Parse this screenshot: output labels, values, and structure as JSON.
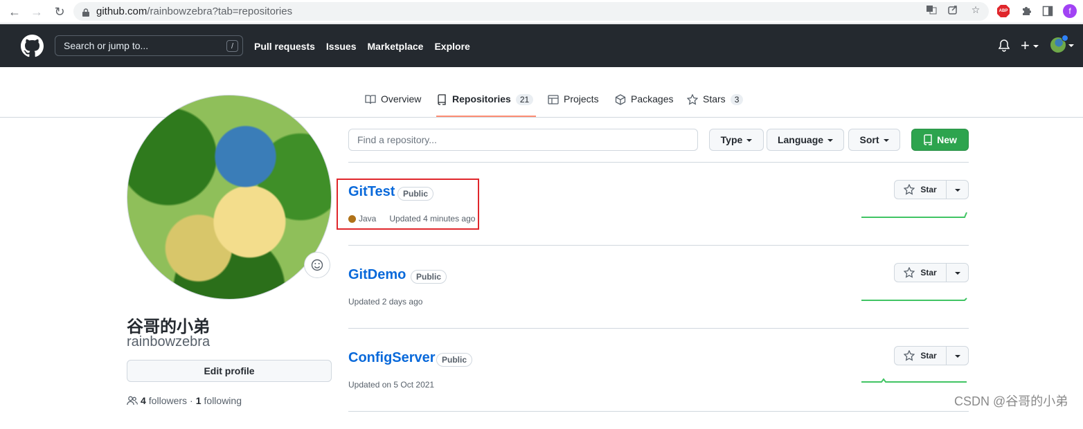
{
  "browser": {
    "url_host": "github.com",
    "url_rest": "/rainbowzebra?tab=repositories",
    "profile_initial": "f",
    "abp_label": "ABP"
  },
  "header": {
    "search_placeholder": "Search or jump to...",
    "search_key": "/",
    "nav": [
      "Pull requests",
      "Issues",
      "Marketplace",
      "Explore"
    ],
    "plus": "+"
  },
  "tabs": [
    {
      "label": "Overview",
      "icon": "book-icon"
    },
    {
      "label": "Repositories",
      "icon": "repo-icon",
      "count": "21"
    },
    {
      "label": "Projects",
      "icon": "table-icon"
    },
    {
      "label": "Packages",
      "icon": "package-icon"
    },
    {
      "label": "Stars",
      "icon": "star-icon",
      "count": "3"
    }
  ],
  "profile": {
    "name": "谷哥的小弟",
    "login": "rainbowzebra",
    "edit_label": "Edit profile",
    "followers": "4",
    "followers_label": "followers",
    "following": "1",
    "following_label": "following"
  },
  "filters": {
    "find_placeholder": "Find a repository...",
    "type_label": "Type",
    "language_label": "Language",
    "sort_label": "Sort",
    "new_label": "New"
  },
  "repos": [
    {
      "name": "GitTest",
      "visibility": "Public",
      "language": "Java",
      "updated": "Updated 4 minutes ago",
      "star_label": "Star"
    },
    {
      "name": "GitDemo",
      "visibility": "Public",
      "updated": "Updated 2 days ago",
      "star_label": "Star"
    },
    {
      "name": "ConfigServer",
      "visibility": "Public",
      "updated": "Updated on 5 Oct 2021",
      "star_label": "Star"
    }
  ],
  "colors": {
    "header_bg": "#24292f",
    "accent_green": "#2da44e",
    "link_blue": "#0969da",
    "java_color": "#b07219",
    "highlight_red": "#e0262b",
    "tab_underline": "#fd8c73"
  },
  "watermark": "CSDN @谷哥的小弟"
}
